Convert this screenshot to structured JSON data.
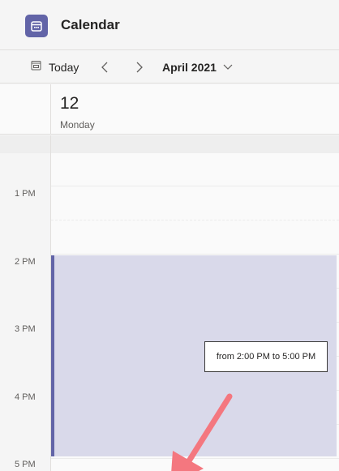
{
  "app": {
    "title": "Calendar",
    "icon": "calendar-app-icon",
    "brand_color": "#6264a7"
  },
  "toolbar": {
    "today_label": "Today",
    "today_icon": "calendar-today-icon",
    "prev_icon": "chevron-left-icon",
    "next_icon": "chevron-right-icon",
    "month_label": "April 2021",
    "month_dropdown_icon": "chevron-down-icon"
  },
  "day": {
    "number": "12",
    "name": "Monday"
  },
  "time_labels": [
    "1 PM",
    "2 PM",
    "3 PM",
    "4 PM",
    "5 PM"
  ],
  "selection": {
    "tooltip_text": "from 2:00 PM to 5:00 PM",
    "fill_color": "#d9d9ea",
    "accent_color": "#6264a7"
  },
  "annotation": {
    "arrow_color": "#f4777f"
  }
}
